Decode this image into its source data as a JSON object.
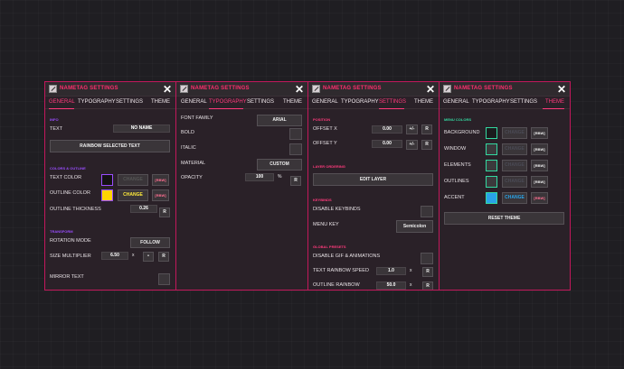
{
  "common": {
    "window_title": "NAMETAG SETTINGS",
    "close": "✕",
    "tabs": [
      "GENERAL",
      "TYPOGRAPHY",
      "SETTINGS",
      "THEME"
    ]
  },
  "panel1": {
    "active_tab": "GENERAL",
    "sections": {
      "info": "INFO",
      "colors": "COLORS & OUTLINE",
      "transform": "TRANSFORM"
    },
    "text_label": "TEXT",
    "text_value": "NO NAME",
    "rainbow_button": "RAINBOW SELECTED TEXT",
    "text_color_label": "TEXT COLOR",
    "text_color_change": "CHANGE",
    "text_color_rbw": "[RBW]",
    "outline_color_label": "OUTLINE COLOR",
    "outline_color_change": "CHANGE",
    "outline_color_rbw": "[RBW]",
    "outline_thickness_label": "OUTLINE THICKNESS",
    "outline_thickness_value": "0.26",
    "reset": "R",
    "rotation_mode_label": "ROTATION MODE",
    "rotation_mode_value": "FOLLOW",
    "size_multiplier_label": "SIZE MULTIPLIER",
    "size_multiplier_value": "6.50",
    "size_x": "x",
    "size_dot": "•",
    "size_reset": "R",
    "mirror_text_label": "MIRROR TEXT",
    "colors": {
      "text_color": "#141214",
      "outline_color": "#ffd400"
    }
  },
  "panel2": {
    "active_tab": "TYPOGRAPHY",
    "font_family_label": "FONT FAMILY",
    "font_family_value": "ARIAL",
    "bold_label": "BOLD",
    "italic_label": "ITALIC",
    "material_label": "MATERIAL",
    "material_value": "CUSTOM",
    "opacity_label": "OPACITY",
    "opacity_value": "100",
    "opacity_unit": "%",
    "opacity_reset": "R"
  },
  "panel3": {
    "active_tab": "SETTINGS",
    "sections": {
      "position": "POSITION",
      "layer": "LAYER ORDERING",
      "keybinds": "KEYBINDS",
      "global": "GLOBAL PRESETS"
    },
    "offset_x_label": "OFFSET X",
    "offset_x_value": "0.00",
    "offset_y_label": "OFFSET Y",
    "offset_y_value": "0.00",
    "plusminus": "+/-",
    "reset": "R",
    "edit_layer": "EDIT LAYER",
    "disable_keybinds_label": "DISABLE KEYBINDS",
    "menu_key_label": "MENU KEY",
    "menu_key_value": "Semicolon",
    "disable_gif_label": "DISABLE GIF & ANIMATIONS",
    "text_rainbow_speed_label": "TEXT RAINBOW SPEED",
    "text_rainbow_speed_value": "1.0",
    "x": "x",
    "outline_rainbow_label": "OUTLINE RAINBOW",
    "outline_rainbow_value": "50.0"
  },
  "panel4": {
    "active_tab": "THEME",
    "section": "MENU COLORS",
    "rows": [
      {
        "label": "BACKGROUND",
        "change": "CHANGE",
        "rbw": "[RBW]",
        "color": "#1b1b1d",
        "active": false
      },
      {
        "label": "WINDOW",
        "change": "CHANGE",
        "rbw": "[RBW]",
        "color": "#3b3a3c",
        "active": false
      },
      {
        "label": "ELEMENTS",
        "change": "CHANGE",
        "rbw": "[RBW]",
        "color": "#3b3a3c",
        "active": false
      },
      {
        "label": "OUTLINES",
        "change": "CHANGE",
        "rbw": "[RBW]",
        "color": "#3b3a3c",
        "active": false
      },
      {
        "label": "ACCENT",
        "change": "CHANGE",
        "rbw": "[RBW]",
        "color": "#29a3e8",
        "active": true
      }
    ],
    "reset_theme": "RESET THEME"
  },
  "theme_colors": {
    "accent": "#ff3a7c",
    "border": "#c2185b",
    "section_purple": "#9a4dff",
    "section_pink": "#ff3a7c",
    "section_green": "#33d9a0"
  }
}
